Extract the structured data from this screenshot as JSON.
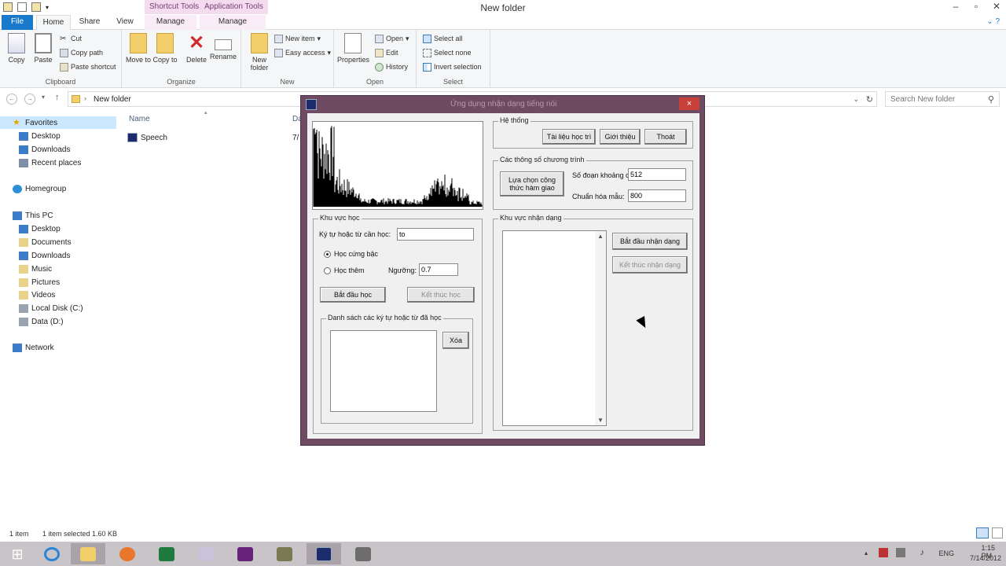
{
  "window": {
    "title": "New folder",
    "ctx_tab_1": "Shortcut Tools",
    "ctx_tab_2": "Application Tools"
  },
  "ribbon_tabs": {
    "file": "File",
    "home": "Home",
    "share": "Share",
    "view": "View",
    "manage_1": "Manage",
    "manage_2": "Manage"
  },
  "ribbon": {
    "clipboard": {
      "label": "Clipboard",
      "copy": "Copy",
      "paste": "Paste",
      "cut": "Cut",
      "copy_path": "Copy path",
      "paste_shortcut": "Paste shortcut"
    },
    "organize": {
      "label": "Organize",
      "move_to": "Move to",
      "copy_to": "Copy to",
      "delete": "Delete",
      "rename": "Rename"
    },
    "new": {
      "label": "New",
      "new_folder": "New folder",
      "new_item": "New item",
      "easy_access": "Easy access"
    },
    "open": {
      "label": "Open",
      "properties": "Properties",
      "open": "Open",
      "edit": "Edit",
      "history": "History"
    },
    "select": {
      "label": "Select",
      "select_all": "Select all",
      "select_none": "Select none",
      "invert": "Invert selection"
    }
  },
  "address": {
    "path": "New folder",
    "search_placeholder": "Search New folder"
  },
  "nav": {
    "favorites": "Favorites",
    "desktop": "Desktop",
    "downloads": "Downloads",
    "recent": "Recent places",
    "homegroup": "Homegroup",
    "thispc": "This PC",
    "desktop2": "Desktop",
    "documents": "Documents",
    "downloads2": "Downloads",
    "music": "Music",
    "pictures": "Pictures",
    "videos": "Videos",
    "local_c": "Local Disk (C:)",
    "data_d": "Data (D:)",
    "network": "Network"
  },
  "filelist": {
    "col_name": "Name",
    "col_date": "Da",
    "file_name": "Speech",
    "file_date": "7/"
  },
  "status": {
    "items": "1 item",
    "selected": "1 item selected  1.60 KB"
  },
  "tray": {
    "lang": "ENG",
    "time": "1:15 PM",
    "date": "7/14/2012"
  },
  "dialog": {
    "title": "Ứng dụng nhận dạng tiếng nói",
    "close": "×",
    "system_group": "Hệ thống",
    "btn_docs": "Tài liệu học trì",
    "btn_intro": "Giới thiệu",
    "btn_exit": "Thoát",
    "params_group": "Các thông số chương trình",
    "btn_choose": "Lựa chọn công thức hàm giao",
    "lbl_segments": "Số đoạn khoảng chia:",
    "val_segments": "512",
    "lbl_norm": "Chuẩn hóa mẫu:",
    "val_norm": "800",
    "learn_group": "Khu vực học",
    "lbl_word": "Ký tự hoặc từ cần học:",
    "val_word": "to",
    "radio_hard": "Học cứng bậc",
    "radio_soft": "Học thêm",
    "lbl_threshold": "Ngưỡng:",
    "val_threshold": "0.7",
    "btn_start_learn": "Bắt đầu học",
    "btn_end_learn": "Kết thúc học",
    "list_group": "Danh sách các ký tự hoặc từ đã học",
    "btn_delete": "Xóa",
    "recog_group": "Khu vực nhận dạng",
    "btn_start_recog": "Bắt đầu nhận dạng",
    "btn_end_recog": "Kết thúc nhận dạng"
  },
  "colors": {
    "accent": "#1979ca",
    "dialog_frame": "#6e4a63",
    "close": "#c7403a",
    "context_tab": "#f4dcef"
  }
}
